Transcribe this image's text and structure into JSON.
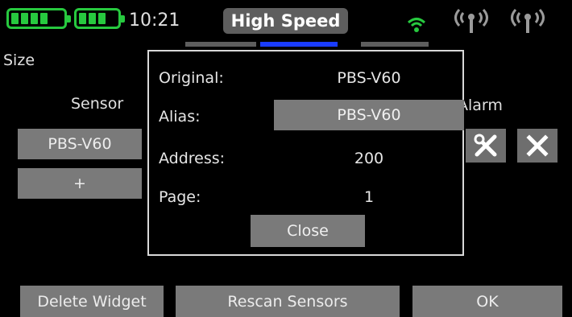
{
  "status_bar": {
    "time": "10:21",
    "mode": "High Speed",
    "battery_color": "#27c93f",
    "wifi_color": "#27c93f",
    "icons": [
      "battery-icon",
      "battery-icon",
      "wifi-icon",
      "antenna-icon",
      "antenna-icon"
    ]
  },
  "page": {
    "size_label": "Size",
    "sensor_header": "Sensor",
    "alarm_header": "Alarm",
    "sensor_value": "PBS-V60",
    "add_label": "+",
    "tab_accent_color": "#1a3cff"
  },
  "modal": {
    "original_label": "Original:",
    "original_value": "PBS-V60",
    "alias_label": "Alias:",
    "alias_value": "PBS-V60",
    "address_label": "Address:",
    "address_value": "200",
    "page_label": "Page:",
    "page_value": "1",
    "close_label": "Close"
  },
  "bottom_bar": {
    "delete_label": "Delete Widget",
    "rescan_label": "Rescan Sensors",
    "ok_label": "OK"
  }
}
